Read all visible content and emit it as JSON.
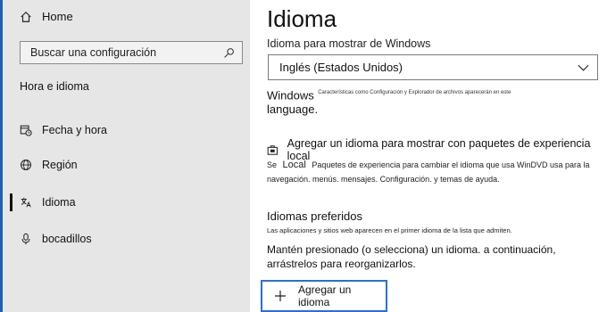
{
  "sidebar": {
    "home_label": "Home",
    "search_placeholder": "Buscar una configuración",
    "section_title": "Hora e idioma",
    "items": [
      {
        "label": "Fecha y hora",
        "icon": "calendar-clock-icon"
      },
      {
        "label": "Región",
        "icon": "globe-icon"
      },
      {
        "label": "Idioma",
        "icon": "language-icon",
        "selected": true
      },
      {
        "label": "bocadillos",
        "icon": "microphone-icon"
      }
    ]
  },
  "main": {
    "title": "Idioma",
    "display_language_label": "Idioma para mostrar de Windows",
    "display_language_value": "Inglés (Estados Unidos)",
    "windows_note_prefix": "Windows",
    "windows_note_small": "Características como Configuración y Explorador de archivos aparecerán en este",
    "windows_note_suffix": "language.",
    "add_display_language": "Agregar un idioma para mostrar con paquetes de experiencia local",
    "local_desc_prefix": "Se",
    "local_desc_local": "Local",
    "local_desc_text": "Paquetes de experiencia para cambiar el idioma que usa WinDVD usa para la navegación. menús. mensajes. Configuración. y temas de ayuda.",
    "preferred_heading": "Idiomas preferidos",
    "preferred_desc": "Las aplicaciones y sitios web aparecen en el primer idioma de la lista que admiten.",
    "reorder_text": "Mantén presionado (o selecciona) un idioma. a continuación, arrástrelos para reorganizarlos.",
    "add_language_button": "Agregar un idioma"
  },
  "colors": {
    "sidebar_bg": "#e6e6e6",
    "accent": "#2b6de0"
  }
}
